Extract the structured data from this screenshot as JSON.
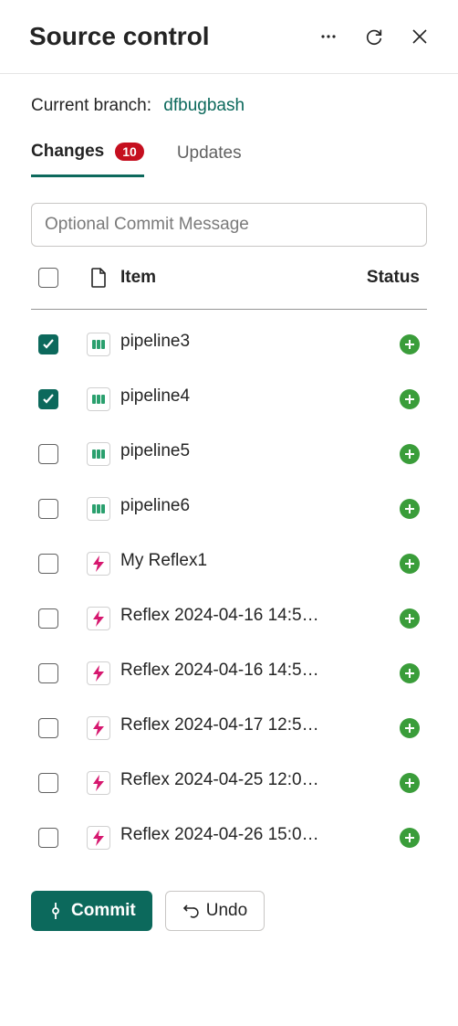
{
  "header": {
    "title": "Source control"
  },
  "branch": {
    "label": "Current branch:",
    "name": "dfbugbash"
  },
  "tabs": {
    "changes": {
      "label": "Changes",
      "badge": "10"
    },
    "updates": {
      "label": "Updates"
    }
  },
  "commitInput": {
    "placeholder": "Optional Commit Message"
  },
  "tableHeader": {
    "item": "Item",
    "status": "Status"
  },
  "items": [
    {
      "name": "pipeline3",
      "type": "pipeline",
      "checked": true,
      "status": "added"
    },
    {
      "name": "pipeline4",
      "type": "pipeline",
      "checked": true,
      "status": "added"
    },
    {
      "name": "pipeline5",
      "type": "pipeline",
      "checked": false,
      "status": "added"
    },
    {
      "name": "pipeline6",
      "type": "pipeline",
      "checked": false,
      "status": "added"
    },
    {
      "name": "My Reflex1",
      "type": "reflex",
      "checked": false,
      "status": "added"
    },
    {
      "name": "Reflex 2024-04-16 14:5…",
      "type": "reflex",
      "checked": false,
      "status": "added"
    },
    {
      "name": "Reflex 2024-04-16 14:5…",
      "type": "reflex",
      "checked": false,
      "status": "added"
    },
    {
      "name": "Reflex 2024-04-17 12:5…",
      "type": "reflex",
      "checked": false,
      "status": "added"
    },
    {
      "name": "Reflex 2024-04-25 12:0…",
      "type": "reflex",
      "checked": false,
      "status": "added"
    },
    {
      "name": "Reflex 2024-04-26 15:0…",
      "type": "reflex",
      "checked": false,
      "status": "added"
    }
  ],
  "buttons": {
    "commit": "Commit",
    "undo": "Undo"
  }
}
